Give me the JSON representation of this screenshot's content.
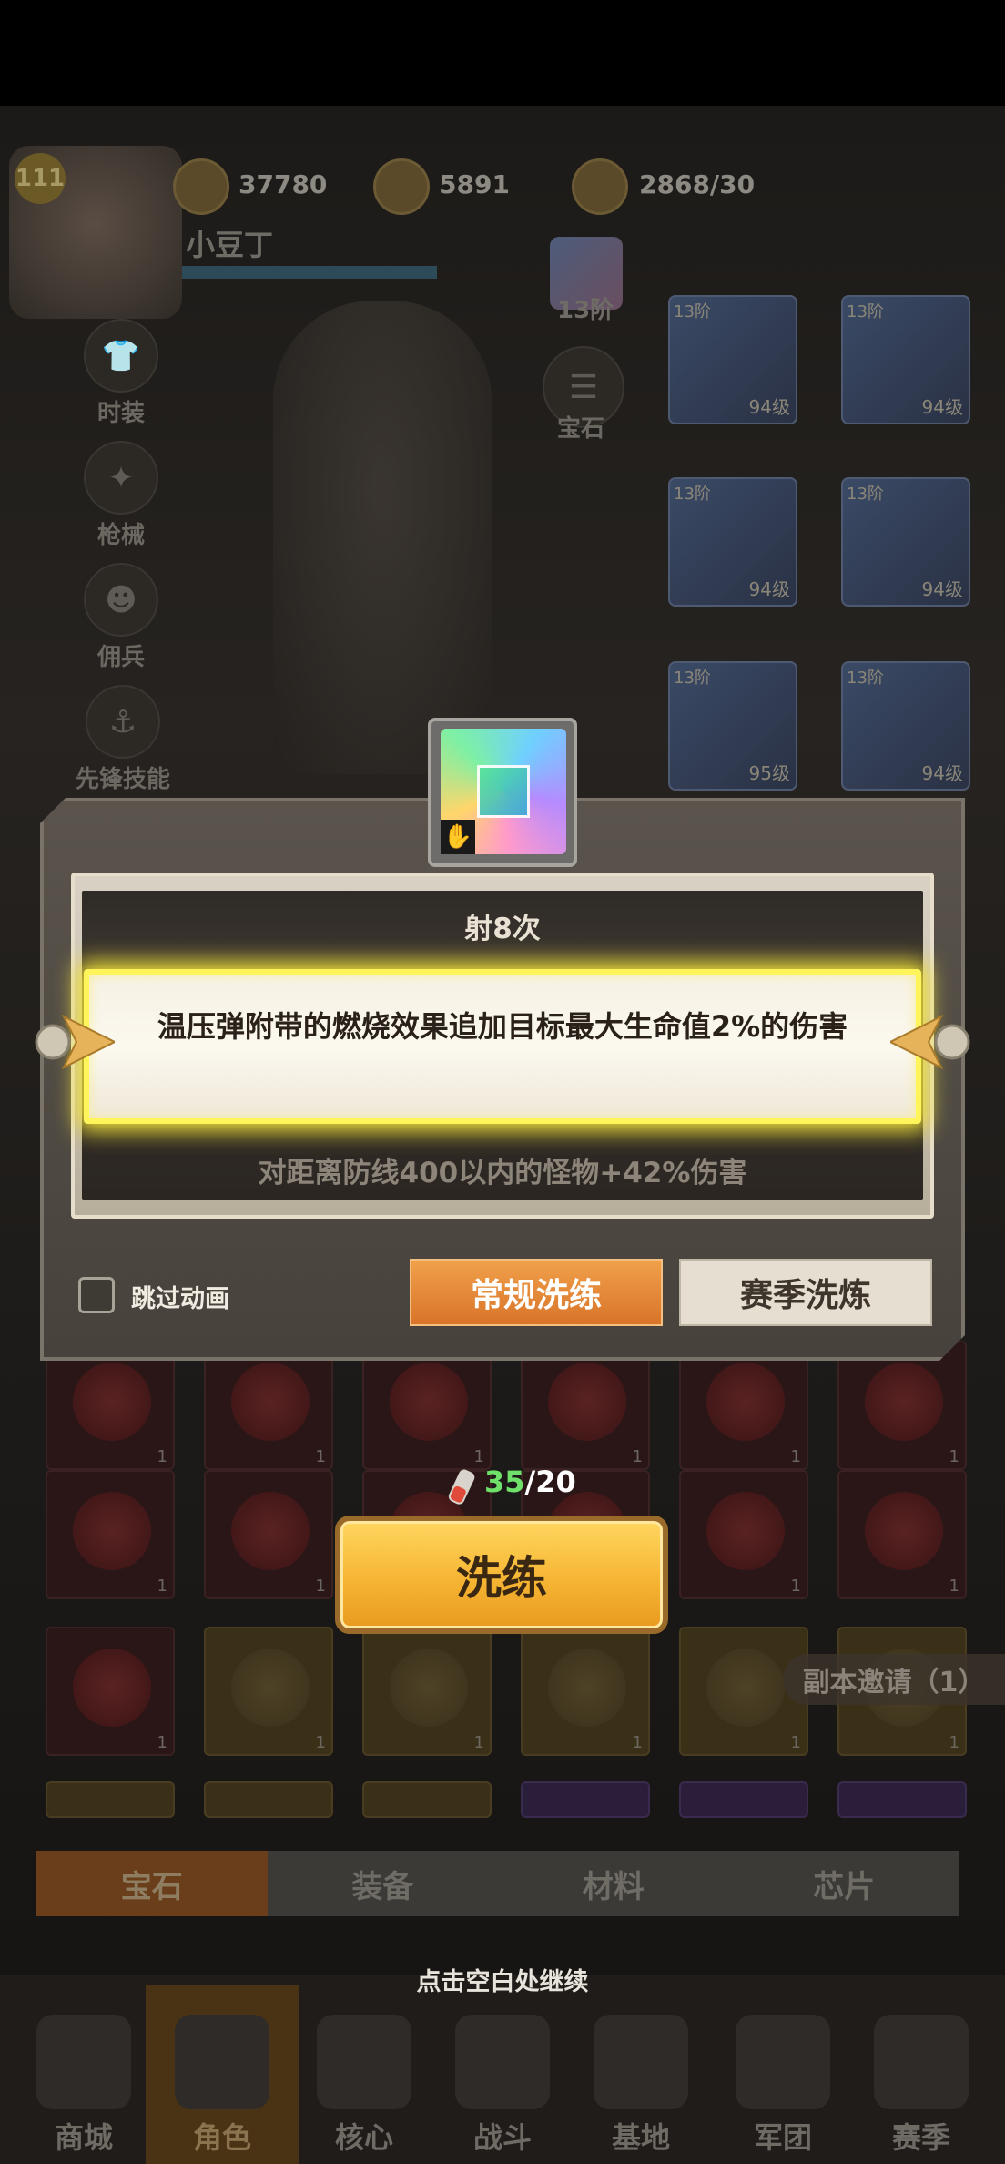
{
  "header": {
    "player_level": "111",
    "player_name": "小豆丁",
    "rank_label": "13阶",
    "resources": [
      {
        "icon": "diamond-icon",
        "value": "37780"
      },
      {
        "icon": "coin-icon",
        "value": "5891"
      },
      {
        "icon": "meat-stamina-icon",
        "value": "2868/30"
      }
    ]
  },
  "side_menu": [
    {
      "icon": "outfit-icon",
      "label": "时装"
    },
    {
      "icon": "gun-icon",
      "label": "枪械"
    },
    {
      "icon": "mercenary-icon",
      "label": "佣兵"
    },
    {
      "icon": "vanguard-skill-icon",
      "label": "先锋技能"
    }
  ],
  "gem_button_label": "宝石",
  "equipment": [
    {
      "tier": "13阶",
      "level": "94级"
    },
    {
      "tier": "13阶",
      "level": "94级"
    },
    {
      "tier": "13阶",
      "level": "94级"
    },
    {
      "tier": "13阶",
      "level": "94级"
    },
    {
      "tier": "13阶",
      "level": "95级"
    },
    {
      "tier": "13阶",
      "level": "94级"
    }
  ],
  "modal": {
    "line_prev": "射8次",
    "line_highlight": "温压弹附带的燃烧效果追加目标最大生命值2%的伤害",
    "line_next": "对距离防线400以内的怪物+42%伤害",
    "skip_label": "跳过动画",
    "btn_normal": "常规洗练",
    "btn_season": "赛季洗炼"
  },
  "refine": {
    "have": "35",
    "need": "/20",
    "button": "洗练"
  },
  "inventory_count": "1",
  "invite_label": "副本邀请（1）",
  "tabs": [
    "宝石",
    "装备",
    "材料",
    "芯片"
  ],
  "continue_hint": "点击空白处继续",
  "bottom_nav": [
    "商城",
    "角色",
    "核心",
    "战斗",
    "基地",
    "军团",
    "赛季"
  ]
}
